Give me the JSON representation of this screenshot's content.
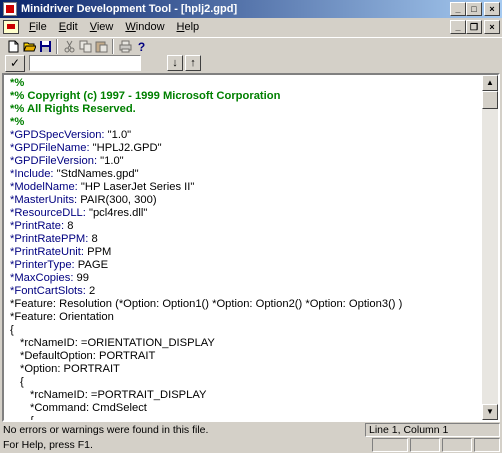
{
  "window": {
    "title": "Minidriver Development Tool - [hplj2.gpd]"
  },
  "menu": [
    {
      "label": "File",
      "accel": "F",
      "rest": "ile"
    },
    {
      "label": "Edit",
      "accel": "E",
      "rest": "dit"
    },
    {
      "label": "View",
      "accel": "V",
      "rest": "iew"
    },
    {
      "label": "Window",
      "accel": "W",
      "rest": "indow"
    },
    {
      "label": "Help",
      "accel": "H",
      "rest": "elp"
    }
  ],
  "toolbar": {
    "icons": [
      "new-icon",
      "open-icon",
      "save-icon",
      "cut-icon",
      "copy-icon",
      "paste-icon",
      "print-icon",
      "help-icon"
    ]
  },
  "search": {
    "value": "",
    "check_glyph": "✓",
    "down_glyph": "↓",
    "up_glyph": "↑"
  },
  "editor": {
    "lines": [
      {
        "text": "*%",
        "type": "comment",
        "indent": 0
      },
      {
        "text": "*% Copyright (c) 1997 - 1999 Microsoft Corporation",
        "type": "comment",
        "indent": 0
      },
      {
        "text": "*% All Rights Reserved.",
        "type": "comment",
        "indent": 0
      },
      {
        "text": "*%",
        "type": "comment",
        "indent": 0
      },
      {
        "kw": "*GPDSpecVersion:",
        "val": " \"1.0\"",
        "indent": 0
      },
      {
        "kw": "*GPDFileName:",
        "val": " \"HPLJ2.GPD\"",
        "indent": 0
      },
      {
        "kw": "*GPDFileVersion:",
        "val": " \"1.0\"",
        "indent": 0
      },
      {
        "kw": "*Include:",
        "val": " \"StdNames.gpd\"",
        "indent": 0
      },
      {
        "kw": "*ModelName:",
        "val": " \"HP LaserJet Series II\"",
        "indent": 0
      },
      {
        "kw": "*MasterUnits:",
        "val": " PAIR(300, 300)",
        "indent": 0
      },
      {
        "kw": "*ResourceDLL:",
        "val": " \"pcl4res.dll\"",
        "indent": 0
      },
      {
        "kw": "*PrintRate:",
        "val": " 8",
        "indent": 0
      },
      {
        "kw": "*PrintRatePPM:",
        "val": " 8",
        "indent": 0
      },
      {
        "kw": "*PrintRateUnit:",
        "val": " PPM",
        "indent": 0
      },
      {
        "kw": "*PrinterType:",
        "val": " PAGE",
        "indent": 0
      },
      {
        "kw": "*MaxCopies:",
        "val": " 99",
        "indent": 0
      },
      {
        "kw": "*FontCartSlots:",
        "val": " 2",
        "indent": 0
      },
      {
        "text": "*Feature: Resolution (*Option: Option1() *Option: Option2() *Option: Option3() )",
        "type": "plain",
        "indent": 0
      },
      {
        "text": "*Feature: Orientation",
        "type": "plain",
        "indent": 0
      },
      {
        "text": "{",
        "type": "plain",
        "indent": 0
      },
      {
        "text": "*rcNameID: =ORIENTATION_DISPLAY",
        "type": "plain",
        "indent": 1
      },
      {
        "text": "*DefaultOption: PORTRAIT",
        "type": "plain",
        "indent": 1
      },
      {
        "text": "*Option: PORTRAIT",
        "type": "plain",
        "indent": 1
      },
      {
        "text": "{",
        "type": "plain",
        "indent": 1
      },
      {
        "text": "*rcNameID: =PORTRAIT_DISPLAY",
        "type": "plain",
        "indent": 2
      },
      {
        "text": "*Command: CmdSelect",
        "type": "plain",
        "indent": 2
      },
      {
        "text": "{",
        "type": "plain",
        "indent": 2
      }
    ]
  },
  "status": {
    "message": "No errors or warnings were found in this file.",
    "position": "Line 1, Column 1",
    "help": "For Help, press F1."
  }
}
